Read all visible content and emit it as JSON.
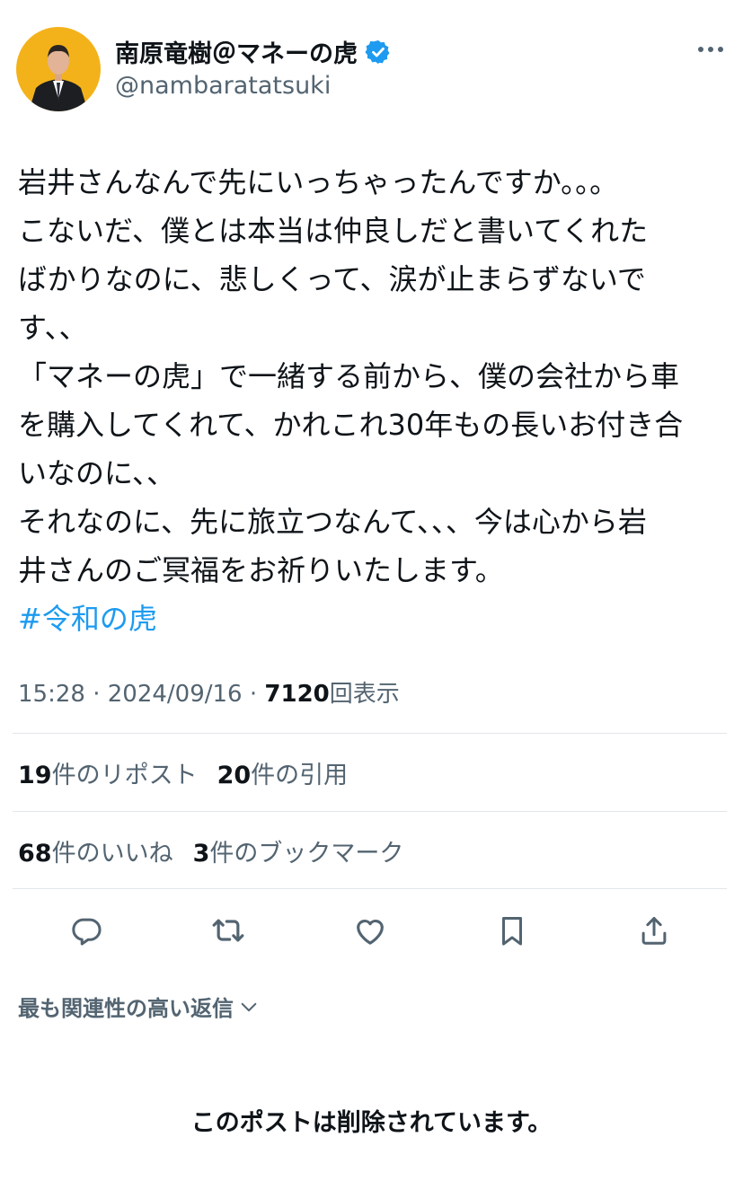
{
  "author": {
    "display_name": "南原竜樹＠マネーの虎",
    "handle": "@nambaratatsuki",
    "verified_icon": "verified-badge-icon",
    "more_icon": "more-icon"
  },
  "tweet": {
    "lines": [
      "岩井さんなんで先にいっちゃったんですか。。。",
      "こないだ、僕とは本当は仲良しだと書いてくれた",
      "ばかりなのに、悲しくって、涙が止まらずないで",
      "す、、",
      "「マネーの虎」で一緒する前から、僕の会社から車",
      "を購入してくれて、かれこれ30年もの長いお付き合",
      "いなのに、、",
      "それなのに、先に旅立つなんて、、、今は心から岩",
      "井さんのご冥福をお祈りいたします。"
    ],
    "hashtag": "#令和の虎"
  },
  "meta": {
    "time": "15:28",
    "separator": "·",
    "date": "2024/09/16",
    "views": "7120",
    "views_label": "回表示"
  },
  "stats": {
    "reposts_count": "19",
    "reposts_label": "件のリポスト",
    "quotes_count": "20",
    "quotes_label": "件の引用",
    "likes_count": "68",
    "likes_label": "件のいいね",
    "bookmarks_count": "3",
    "bookmarks_label": "件のブックマーク"
  },
  "actions": [
    "reply-icon",
    "repost-icon",
    "like-icon",
    "bookmark-icon",
    "share-icon"
  ],
  "replies": {
    "sort_label": "最も関連性の高い返信",
    "deleted_notice": "このポストは削除されています。"
  },
  "colors": {
    "accent": "#1d9bf0",
    "secondary_text": "#536471",
    "avatar_background": "#f4b21a"
  }
}
